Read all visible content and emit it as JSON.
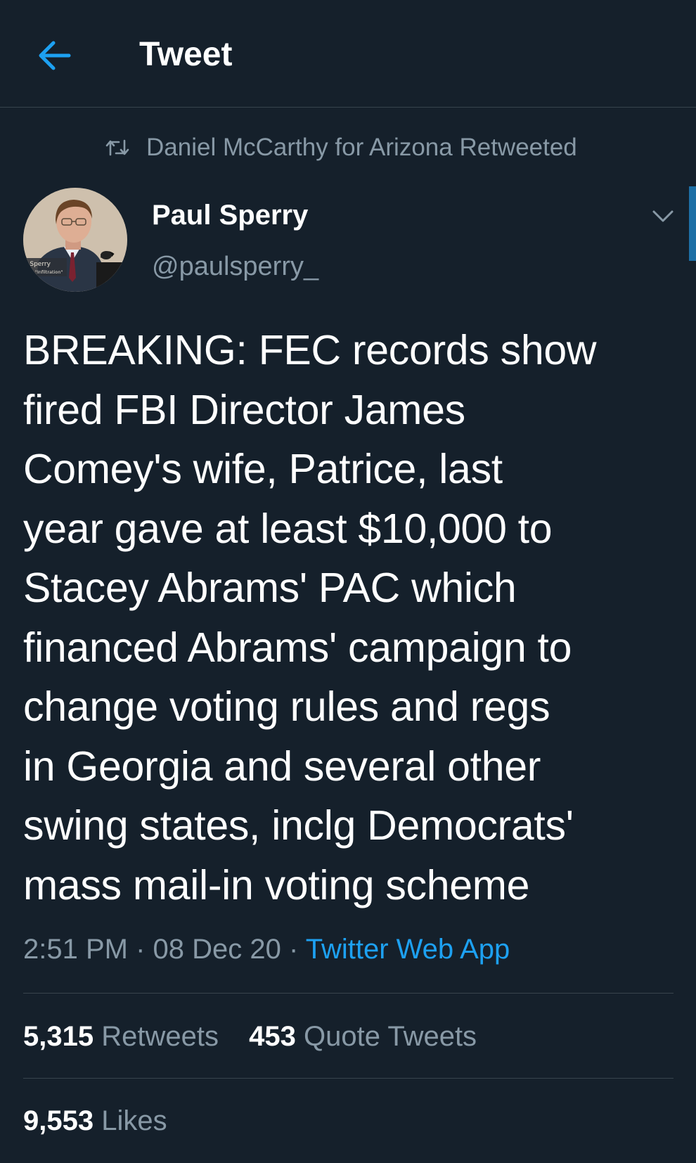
{
  "header": {
    "title": "Tweet",
    "back_icon": "arrow-left-icon",
    "accent": "#1da1f2"
  },
  "retweet_context": {
    "icon": "retweet-icon",
    "text": "Daniel McCarthy for Arizona Retweeted"
  },
  "author": {
    "name": "Paul Sperry",
    "handle": "@paulsperry_",
    "avatar_caption_1": "l Sperry",
    "avatar_caption_2": "hor, \"Infiltration\""
  },
  "tweet": {
    "lines": [
      "BREAKING: FEC records show",
      "fired FBI Director James",
      "Comey's wife, Patrice, last",
      "year gave at least $10,000 to",
      "Stacey Abrams' PAC which",
      "financed Abrams' campaign to",
      "change voting rules and regs",
      "in Georgia and several other",
      "swing states, inclg Democrats'",
      "mass mail-in voting scheme"
    ],
    "time": "2:51 PM",
    "date": "08 Dec 20",
    "separator": "·",
    "source": "Twitter Web App"
  },
  "stats": {
    "retweets_count": "5,315",
    "retweets_label": "Retweets",
    "quotes_count": "453",
    "quotes_label": "Quote Tweets",
    "likes_count": "9,553",
    "likes_label": "Likes"
  },
  "colors": {
    "background": "#15202b",
    "secondary_text": "#8899a6",
    "divider": "#38444d",
    "link": "#1da1f2"
  }
}
